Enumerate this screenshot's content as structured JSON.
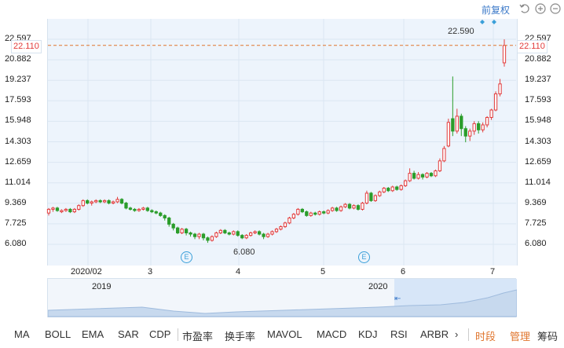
{
  "toolbar": {
    "fq_label": "前复权",
    "icons": [
      "undo-icon",
      "zoom-in-icon",
      "zoom-out-icon"
    ]
  },
  "price": {
    "current": "22.110",
    "max_label": "22.590",
    "min_label": "6.080"
  },
  "colors": {
    "up": "#e23b3b",
    "down": "#2a9d2a",
    "plot_bg": "#edf4fc",
    "accent": "#e0752d",
    "link": "#3a78c8"
  },
  "axis": {
    "y_ticks": [
      "22.597",
      "20.882",
      "19.237",
      "17.593",
      "15.948",
      "14.303",
      "12.659",
      "11.014",
      "9.369",
      "7.725",
      "6.080"
    ],
    "x_ticks": [
      "2020/02",
      "3",
      "4",
      "5",
      "6",
      "7"
    ]
  },
  "navigator": {
    "labels": [
      "2019",
      "2020"
    ]
  },
  "indicators": [
    "MA",
    "BOLL",
    "EMA",
    "SAR",
    "CDP",
    "市盈率",
    "换手率",
    "MAVOL",
    "MACD",
    "KDJ",
    "RSI",
    "ARBR"
  ],
  "indicators_more": "›",
  "right_tabs": [
    "时段",
    "管理",
    "筹码"
  ],
  "event_markers": [
    "E",
    "E"
  ],
  "chart_data": {
    "type": "candlestick",
    "ylim": [
      6.08,
      22.597
    ],
    "candles": [
      [
        8.6,
        8.9,
        8.4,
        9.0
      ],
      [
        8.9,
        9.0,
        8.7,
        9.1
      ],
      [
        9.0,
        8.8,
        8.7,
        9.1
      ],
      [
        8.7,
        8.8,
        8.6,
        8.9
      ],
      [
        8.8,
        8.9,
        8.7,
        9.0
      ],
      [
        8.9,
        8.7,
        8.6,
        9.0
      ],
      [
        8.7,
        8.9,
        8.6,
        9.0
      ],
      [
        8.9,
        9.2,
        8.8,
        9.3
      ],
      [
        9.2,
        9.6,
        9.1,
        9.7
      ],
      [
        9.6,
        9.4,
        9.3,
        9.7
      ],
      [
        9.4,
        9.5,
        9.2,
        9.6
      ],
      [
        9.5,
        9.6,
        9.4,
        9.7
      ],
      [
        9.6,
        9.5,
        9.4,
        9.7
      ],
      [
        9.5,
        9.6,
        9.4,
        9.7
      ],
      [
        9.6,
        9.4,
        9.3,
        9.7
      ],
      [
        9.4,
        9.5,
        9.3,
        9.6
      ],
      [
        9.5,
        9.7,
        9.4,
        9.9
      ],
      [
        9.7,
        9.4,
        9.3,
        9.8
      ],
      [
        9.4,
        9.0,
        8.9,
        9.5
      ],
      [
        9.0,
        8.9,
        8.8,
        9.1
      ],
      [
        8.9,
        8.8,
        8.7,
        9.0
      ],
      [
        8.8,
        8.9,
        8.7,
        9.0
      ],
      [
        8.9,
        9.0,
        8.8,
        9.1
      ],
      [
        9.0,
        8.8,
        8.7,
        9.1
      ],
      [
        8.8,
        8.7,
        8.6,
        8.9
      ],
      [
        8.7,
        8.6,
        8.5,
        8.8
      ],
      [
        8.6,
        8.4,
        8.3,
        8.7
      ],
      [
        8.4,
        8.2,
        8.0,
        8.5
      ],
      [
        8.2,
        7.7,
        7.5,
        8.3
      ],
      [
        7.7,
        7.4,
        7.2,
        7.8
      ],
      [
        7.4,
        7.0,
        6.9,
        7.5
      ],
      [
        7.0,
        7.3,
        6.9,
        7.4
      ],
      [
        7.3,
        7.0,
        6.8,
        7.4
      ],
      [
        7.0,
        6.9,
        6.7,
        7.1
      ],
      [
        6.9,
        6.7,
        6.5,
        7.0
      ],
      [
        6.7,
        6.9,
        6.5,
        7.0
      ],
      [
        6.9,
        6.6,
        6.4,
        7.0
      ],
      [
        6.6,
        6.4,
        6.2,
        6.7
      ],
      [
        6.4,
        6.7,
        6.3,
        6.8
      ],
      [
        6.7,
        7.0,
        6.6,
        7.1
      ],
      [
        7.0,
        7.2,
        6.9,
        7.3
      ],
      [
        7.2,
        7.0,
        6.9,
        7.3
      ],
      [
        7.0,
        6.9,
        6.8,
        7.1
      ],
      [
        6.9,
        7.1,
        6.8,
        7.2
      ],
      [
        7.1,
        6.8,
        6.7,
        7.2
      ],
      [
        6.8,
        6.6,
        6.5,
        6.9
      ],
      [
        6.6,
        6.8,
        6.5,
        6.9
      ],
      [
        6.8,
        7.0,
        6.7,
        7.1
      ],
      [
        7.0,
        7.1,
        6.9,
        7.2
      ],
      [
        7.1,
        6.9,
        6.8,
        7.2
      ],
      [
        6.9,
        6.7,
        6.5,
        7.0
      ],
      [
        6.7,
        6.9,
        6.6,
        7.0
      ],
      [
        6.9,
        7.1,
        6.8,
        7.2
      ],
      [
        7.1,
        7.3,
        7.0,
        7.4
      ],
      [
        7.3,
        7.5,
        7.2,
        7.6
      ],
      [
        7.5,
        7.8,
        7.4,
        7.9
      ],
      [
        7.8,
        8.2,
        7.7,
        8.3
      ],
      [
        8.2,
        8.5,
        8.1,
        8.6
      ],
      [
        8.5,
        8.9,
        8.4,
        9.0
      ],
      [
        8.9,
        8.7,
        8.6,
        9.0
      ],
      [
        8.7,
        8.4,
        8.3,
        8.8
      ],
      [
        8.4,
        8.6,
        8.3,
        8.7
      ],
      [
        8.6,
        8.5,
        8.4,
        8.7
      ],
      [
        8.5,
        8.7,
        8.4,
        8.8
      ],
      [
        8.7,
        8.6,
        8.5,
        8.8
      ],
      [
        8.6,
        8.8,
        8.5,
        8.9
      ],
      [
        8.8,
        9.0,
        8.7,
        9.1
      ],
      [
        9.0,
        8.8,
        8.7,
        9.1
      ],
      [
        8.8,
        9.1,
        8.7,
        9.2
      ],
      [
        9.1,
        9.3,
        9.0,
        9.4
      ],
      [
        9.3,
        9.0,
        8.9,
        9.4
      ],
      [
        9.0,
        9.2,
        8.9,
        9.3
      ],
      [
        9.2,
        8.9,
        8.8,
        9.3
      ],
      [
        8.9,
        9.4,
        8.8,
        9.5
      ],
      [
        9.4,
        10.2,
        9.3,
        10.4
      ],
      [
        10.2,
        9.6,
        9.5,
        10.3
      ],
      [
        9.6,
        10.0,
        9.5,
        10.1
      ],
      [
        10.0,
        10.3,
        9.9,
        10.4
      ],
      [
        10.3,
        10.6,
        10.2,
        10.7
      ],
      [
        10.6,
        10.4,
        10.3,
        10.7
      ],
      [
        10.4,
        10.7,
        10.3,
        10.8
      ],
      [
        10.7,
        10.5,
        10.4,
        10.8
      ],
      [
        10.5,
        10.8,
        10.4,
        10.9
      ],
      [
        10.8,
        11.2,
        10.7,
        11.3
      ],
      [
        11.2,
        11.8,
        11.1,
        12.2
      ],
      [
        11.8,
        11.4,
        11.3,
        12.0
      ],
      [
        11.4,
        11.7,
        11.3,
        11.9
      ],
      [
        11.7,
        11.5,
        11.3,
        11.8
      ],
      [
        11.5,
        11.8,
        11.4,
        11.9
      ],
      [
        11.8,
        11.6,
        11.5,
        11.9
      ],
      [
        11.6,
        12.0,
        11.5,
        12.1
      ],
      [
        12.0,
        12.8,
        11.9,
        13.0
      ],
      [
        12.8,
        13.8,
        12.7,
        14.0
      ],
      [
        14.0,
        15.9,
        13.9,
        16.2
      ],
      [
        16.2,
        15.2,
        14.8,
        19.6
      ],
      [
        15.2,
        16.4,
        15.0,
        17.0
      ],
      [
        16.4,
        15.4,
        14.8,
        16.6
      ],
      [
        15.4,
        14.8,
        14.3,
        15.6
      ],
      [
        14.8,
        15.2,
        14.4,
        15.4
      ],
      [
        15.2,
        15.8,
        14.9,
        16.0
      ],
      [
        15.8,
        15.3,
        15.0,
        16.0
      ],
      [
        15.3,
        15.7,
        15.1,
        15.9
      ],
      [
        15.7,
        16.3,
        15.5,
        16.4
      ],
      [
        16.3,
        16.9,
        16.1,
        17.0
      ],
      [
        16.9,
        18.2,
        16.8,
        18.4
      ],
      [
        18.2,
        19.0,
        18.0,
        19.4
      ],
      [
        20.7,
        22.1,
        20.4,
        22.59
      ]
    ]
  }
}
